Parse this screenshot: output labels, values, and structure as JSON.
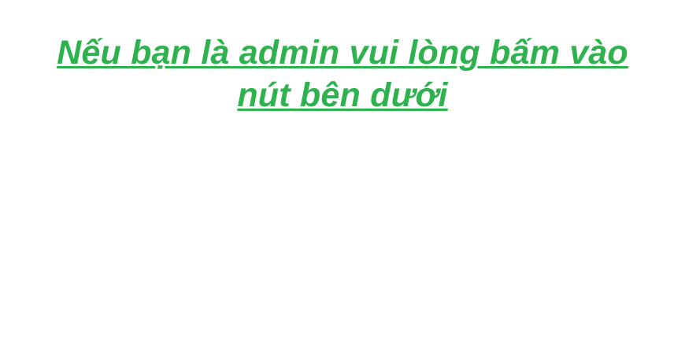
{
  "message": {
    "text": "Nếu bạn là admin vui lòng bấm vào nút bên dưới",
    "color": "#2db24d"
  }
}
